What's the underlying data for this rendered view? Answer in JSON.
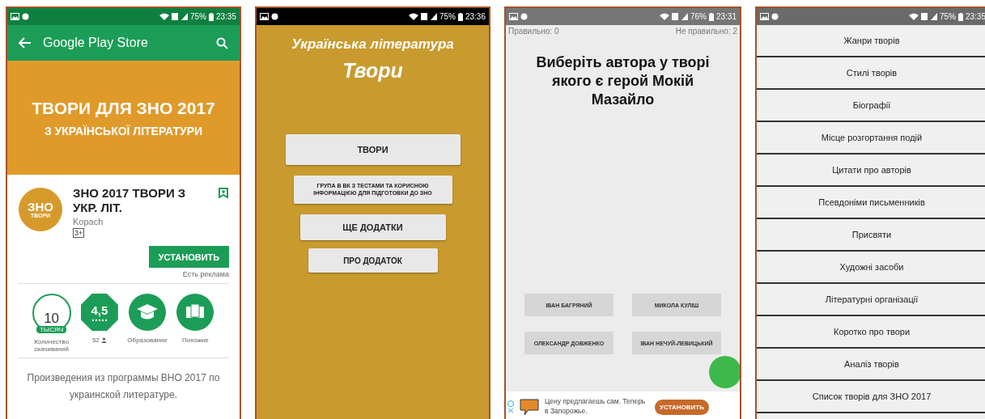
{
  "phones": [
    {
      "kind": "store",
      "status_bar": {
        "battery": "75%",
        "time": "23:35"
      },
      "toolbar": {
        "title": "Google Play Store"
      },
      "banner": {
        "title": "ТВОРИ ДЛЯ ЗНО 2017",
        "subtitle": "З УКРАЇНСЬКОЇ ЛІТЕРАТУРИ"
      },
      "app": {
        "logo_top": "ЗНО",
        "logo_bottom": "ТВОРИ",
        "name": "ЗНО 2017 ТВОРИ З УКР. ЛІТ.",
        "developer": "Kopach",
        "age_rating": "3+",
        "install_button": "УСТАНОВИТЬ",
        "ads_note": "Есть реклама"
      },
      "stats": [
        {
          "kind": "downloads",
          "value": "10",
          "badge": "ТЫСЯЧ",
          "label": "Количество скачиваний"
        },
        {
          "kind": "rating",
          "value": "4,5",
          "label": "52"
        },
        {
          "kind": "category",
          "label": "Образование"
        },
        {
          "kind": "similar",
          "label": "Похожие"
        }
      ],
      "description": "Произведения из программы ВНО 2017 по украинской литературе."
    },
    {
      "kind": "menu",
      "status_bar": {
        "battery": "75%",
        "time": "23:36"
      },
      "title": "Українська література",
      "subtitle": "Твори",
      "buttons": [
        "ТВОРИ",
        "ГРУПА В ВК З ТЕСТАМИ ТА КОРИСНОЮ ІНФОРМАЦІЄЮ ДЛЯ ПІДГОТОВКИ ДО ЗНО",
        "ЩЕ ДОДАТКИ",
        "ПРО ДОДАТОК"
      ]
    },
    {
      "kind": "quiz",
      "status_bar": {
        "battery": "76%",
        "time": "23:31"
      },
      "correct": "Правильно: 0",
      "wrong": "Не правильно: 2",
      "question": "Виберіть автора у творі якого є герой Мокій Мазайло",
      "answers": [
        "ІВАН БАГРЯНИЙ",
        "МИКОЛА КУЛІШ",
        "ОЛЕКСАНДР ДОВЖЕНКО",
        "ІВАН НЕЧУЙ-ЛЕВИЦЬКИЙ"
      ],
      "ad": {
        "text": "Цену предлагаешь сам. Теперь в Запорожье.",
        "button": "УСТАНОВИТЬ"
      }
    },
    {
      "kind": "list",
      "status_bar": {
        "battery": "75%",
        "time": "23:35"
      },
      "items": [
        "Жанри творів",
        "Стилі творів",
        "Біографії",
        "Місце розгортання подій",
        "Цитати про авторів",
        "Псевдоніми письменників",
        "Присвяти",
        "Художні засоби",
        "Літературні організації",
        "Коротко про твори",
        "Аналіз творів",
        "Список творів для ЗНО 2017"
      ]
    }
  ]
}
